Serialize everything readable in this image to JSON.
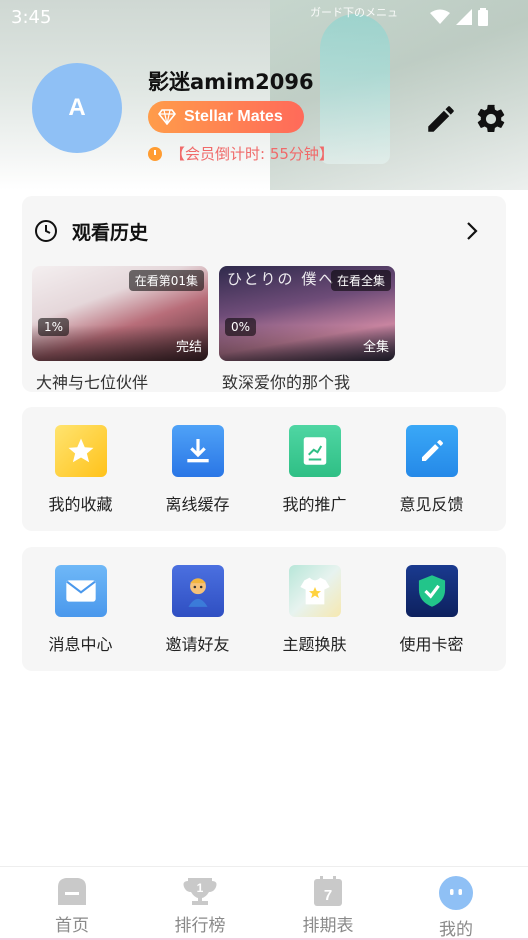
{
  "status_bar": {
    "time": "3:45"
  },
  "header": {
    "bg_text": "ガード下のメニュ",
    "avatar_letter": "A",
    "username": "影迷amim2096",
    "vip_label": "Stellar Mates",
    "countdown": "【会员倒计时: 55分钟】",
    "edit_icon": "pencil-icon",
    "settings_icon": "gear-icon"
  },
  "history": {
    "title": "观看历史",
    "items": [
      {
        "title": "大神与七位伙伴",
        "badge": "在看第01集",
        "progress": "1%",
        "status": "完结"
      },
      {
        "title": "致深爱你的那个我",
        "badge": "在看全集",
        "progress": "0%",
        "status": "全集",
        "art_text": "ひとりの 僕へ"
      }
    ]
  },
  "features_row1": [
    {
      "label": "我的收藏",
      "icon": "star-icon",
      "color": "#ffd23f"
    },
    {
      "label": "离线缓存",
      "icon": "download-icon",
      "color": "#3d8ef0"
    },
    {
      "label": "我的推广",
      "icon": "promotion-icon",
      "color": "#3ecf97"
    },
    {
      "label": "意见反馈",
      "icon": "edit-feedback-icon",
      "color": "#2f9bf0"
    }
  ],
  "features_row2": [
    {
      "label": "消息中心",
      "icon": "mail-icon",
      "color": "#5aa9f2"
    },
    {
      "label": "邀请好友",
      "icon": "invite-friend-icon",
      "color": "#3f63d8"
    },
    {
      "label": "主题换肤",
      "icon": "tshirt-icon",
      "color": "#9fd8c8"
    },
    {
      "label": "使用卡密",
      "icon": "shield-check-icon",
      "color": "#122a74"
    }
  ],
  "bottom_nav": [
    {
      "label": "首页",
      "icon": "home-icon"
    },
    {
      "label": "排行榜",
      "icon": "trophy-icon",
      "number": "1"
    },
    {
      "label": "排期表",
      "icon": "calendar-icon",
      "number": "7"
    },
    {
      "label": "我的",
      "icon": "profile-face-icon"
    }
  ]
}
